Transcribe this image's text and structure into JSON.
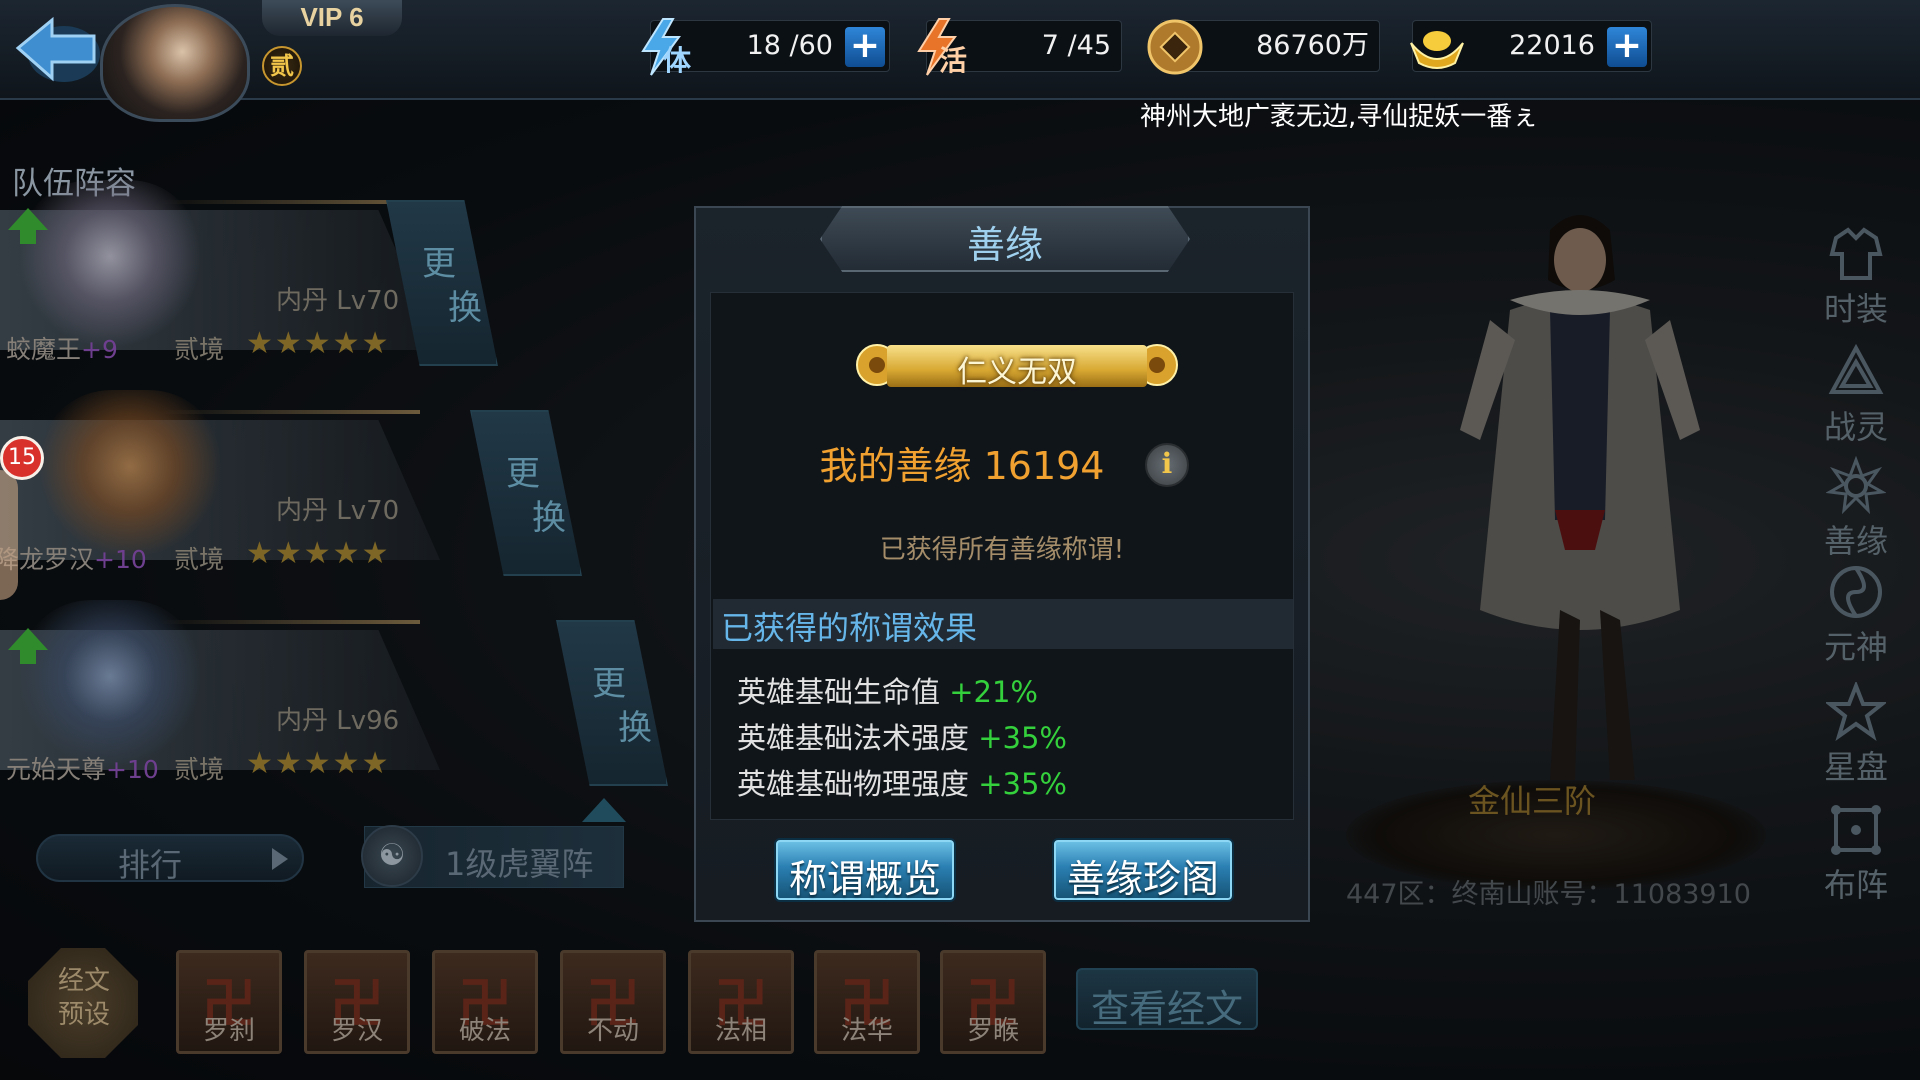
{
  "header": {
    "vip": "VIP 6",
    "rank_badge": "贰",
    "stamina": {
      "icon": "lightning-icon",
      "label": "体",
      "value": "18 /60"
    },
    "vitality": {
      "icon": "lightning-icon",
      "label": "活",
      "value": "7 /45"
    },
    "coins": {
      "icon": "copper-coin-icon",
      "value": "86760万"
    },
    "gold": {
      "icon": "gold-ingot-icon",
      "value": "22016"
    },
    "marquee": "神州大地广袤无边,寻仙捉妖一番ぇ"
  },
  "team": {
    "title": "队伍阵容",
    "heroes": [
      {
        "name": "蛟魔王",
        "plus": "+9",
        "realm": "贰境",
        "level": "内丹 Lv70",
        "stars": 5,
        "swap_top": "更",
        "swap_bottom": "换"
      },
      {
        "name": "降龙罗汉",
        "plus": "+10",
        "realm": "贰境",
        "level": "内丹 Lv70",
        "stars": 5,
        "swap_top": "更",
        "swap_bottom": "换"
      },
      {
        "name": "元始天尊",
        "plus": "+10",
        "realm": "贰境",
        "level": "内丹 Lv96",
        "stars": 5,
        "swap_top": "更",
        "swap_bottom": "换"
      }
    ],
    "rank_button": "排行",
    "formation_button": "1级虎翼阵",
    "notification_count": "15"
  },
  "sutra": {
    "preset_label": "经文预设",
    "slots": [
      "罗刹",
      "罗汉",
      "破法",
      "不动",
      "法相",
      "法华",
      "罗睺"
    ],
    "view_button": "查看经文"
  },
  "side_menu": [
    {
      "label": "时装",
      "icon": "costume-icon"
    },
    {
      "label": "战灵",
      "icon": "war-spirit-icon"
    },
    {
      "label": "善缘",
      "icon": "karma-icon"
    },
    {
      "label": "元神",
      "icon": "soul-icon"
    },
    {
      "label": "星盘",
      "icon": "star-chart-icon"
    },
    {
      "label": "布阵",
      "icon": "formation-icon"
    }
  ],
  "hero_display": {
    "title": "金仙三阶",
    "server": "447区：终南山账号：11083910"
  },
  "dialog": {
    "title": "善缘",
    "rank_title": "仁义无双",
    "my_karma": "我的善缘 16194",
    "all_obtained": "已获得所有善缘称谓!",
    "effects_header": "已获得的称谓效果",
    "effects": [
      {
        "label": "英雄基础生命值",
        "value": "+21%"
      },
      {
        "label": "英雄基础法术强度",
        "value": "+35%"
      },
      {
        "label": "英雄基础物理强度",
        "value": "+35%"
      }
    ],
    "overview_button": "称谓概览",
    "treasure_button": "善缘珍阁"
  },
  "colors": {
    "karma_orange": "#f0a12f",
    "effect_green": "#34d13c",
    "header_blue": "#66b6ea"
  }
}
